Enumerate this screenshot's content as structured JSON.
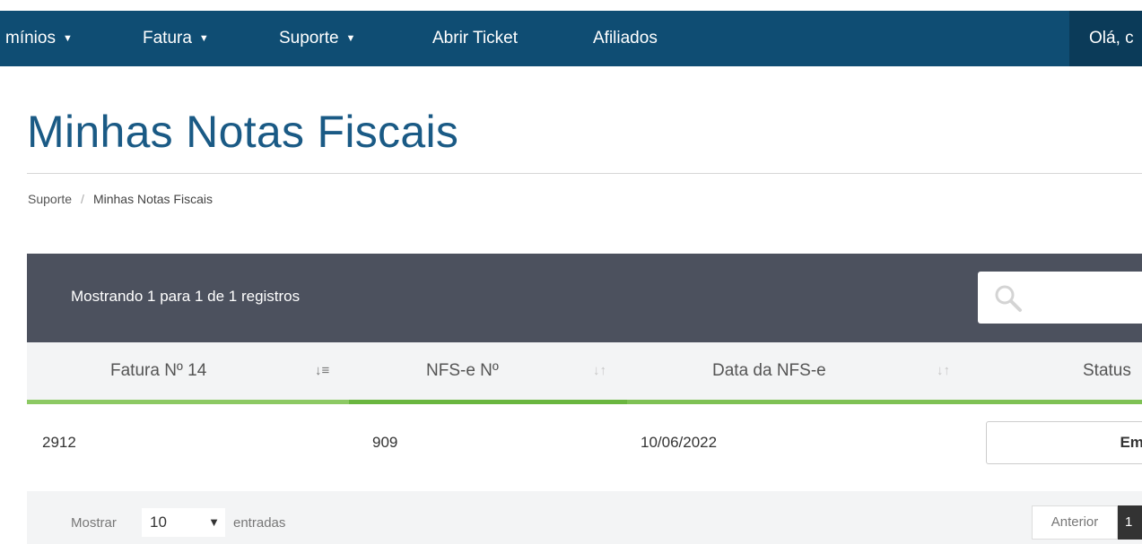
{
  "nav": {
    "items": [
      {
        "label": "mínios",
        "caret": true
      },
      {
        "label": "Fatura",
        "caret": true
      },
      {
        "label": "Suporte",
        "caret": true
      },
      {
        "label": "Abrir Ticket",
        "caret": false
      },
      {
        "label": "Afiliados",
        "caret": false
      }
    ],
    "user_greeting": "Olá, c",
    "caret_icon": "caret-down-icon"
  },
  "page": {
    "title": "Minhas Notas Fiscais"
  },
  "breadcrumb": {
    "items": [
      "Suporte",
      "Minhas Notas Fiscais"
    ],
    "separator": "/"
  },
  "table": {
    "info": "Mostrando 1 para 1 de 1 registros",
    "search_icon": "search-icon",
    "columns": [
      {
        "label": "Fatura Nº 14",
        "sort": "sort-amount-asc-icon"
      },
      {
        "label": "NFS-e Nº",
        "sort": "sort-icon"
      },
      {
        "label": "Data da NFS-e",
        "sort": "sort-icon"
      },
      {
        "label": "Status",
        "sort": ""
      }
    ],
    "rows": [
      {
        "invoice": "2912",
        "nfse": "909",
        "date": "10/06/2022",
        "status": "Emiti"
      }
    ],
    "accent_color": "#7ec154",
    "header_bar_color": "#4c515e"
  },
  "footer": {
    "show_label": "Mostrar",
    "page_size": "10",
    "entries_label": "entradas",
    "previous_label": "Anterior",
    "current_page": "1"
  },
  "colors": {
    "nav_bg": "#0f4d73",
    "title": "#1a5a85"
  }
}
